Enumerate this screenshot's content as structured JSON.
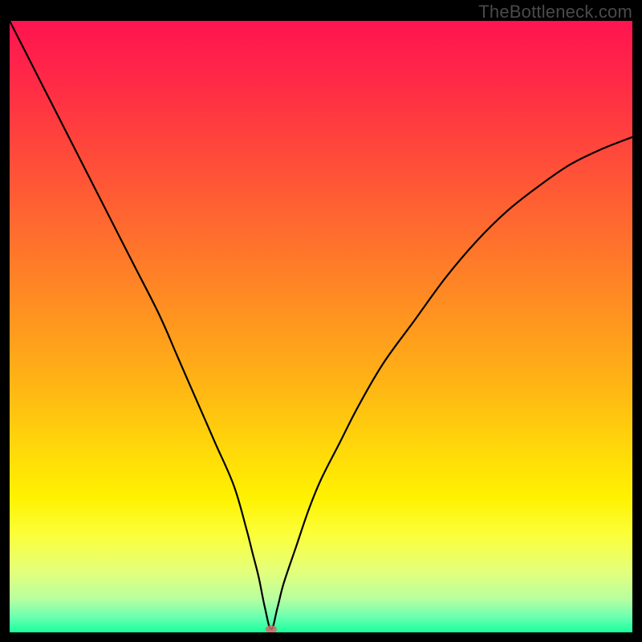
{
  "watermark": "TheBottleneck.com",
  "colors": {
    "gradient_stops": [
      {
        "offset": 0.0,
        "color": "#ff1450"
      },
      {
        "offset": 0.1,
        "color": "#ff2a46"
      },
      {
        "offset": 0.22,
        "color": "#ff4a3a"
      },
      {
        "offset": 0.35,
        "color": "#ff6e2e"
      },
      {
        "offset": 0.48,
        "color": "#ff9320"
      },
      {
        "offset": 0.6,
        "color": "#ffb614"
      },
      {
        "offset": 0.7,
        "color": "#ffd80a"
      },
      {
        "offset": 0.78,
        "color": "#fff200"
      },
      {
        "offset": 0.84,
        "color": "#fbff3a"
      },
      {
        "offset": 0.9,
        "color": "#e4ff7a"
      },
      {
        "offset": 0.945,
        "color": "#b8ffa0"
      },
      {
        "offset": 0.975,
        "color": "#6affb0"
      },
      {
        "offset": 1.0,
        "color": "#18ff9e"
      }
    ],
    "curve_color": "#000000",
    "marker_color": "#d46a6a"
  },
  "chart_data": {
    "type": "line",
    "title": "",
    "xlabel": "",
    "ylabel": "",
    "xlim": [
      0,
      100
    ],
    "ylim": [
      0,
      100
    ],
    "legend": false,
    "grid": false,
    "annotations": [],
    "x": [
      0,
      4,
      8,
      12,
      16,
      20,
      24,
      27,
      30,
      33,
      36,
      38,
      39,
      40,
      41,
      42,
      43,
      44,
      46,
      48,
      50,
      53,
      56,
      60,
      65,
      70,
      75,
      80,
      85,
      90,
      95,
      100
    ],
    "values": [
      100,
      92,
      84,
      76,
      68,
      60,
      52,
      45,
      38,
      31,
      24,
      17,
      13,
      9,
      4,
      0.5,
      4,
      8,
      14,
      20,
      25,
      31,
      37,
      44,
      51,
      58,
      64,
      69,
      73,
      76.5,
      79,
      81
    ],
    "marker": {
      "x": 42,
      "y": 0.5
    }
  }
}
